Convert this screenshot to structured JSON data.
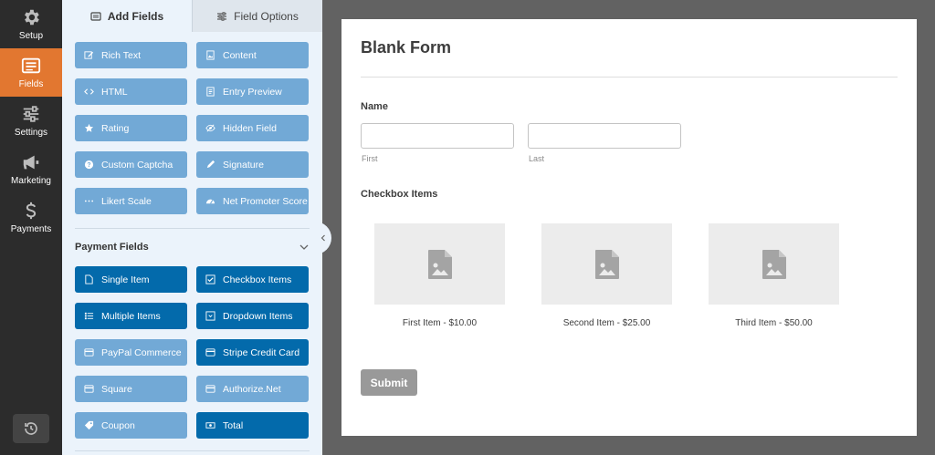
{
  "nav": {
    "items": [
      {
        "label": "Setup",
        "icon": "gear-icon"
      },
      {
        "label": "Fields",
        "icon": "fields-list-icon"
      },
      {
        "label": "Settings",
        "icon": "sliders-icon"
      },
      {
        "label": "Marketing",
        "icon": "megaphone-icon"
      },
      {
        "label": "Payments",
        "icon": "dollar-icon"
      }
    ],
    "active": "Fields",
    "history_icon": "history-icon"
  },
  "tabs": {
    "add_fields": "Add Fields",
    "field_options": "Field Options"
  },
  "fancy_fields": [
    {
      "label": "Rich Text",
      "icon": "pencil-square-icon"
    },
    {
      "label": "Content",
      "icon": "image-doc-icon"
    },
    {
      "label": "HTML",
      "icon": "code-icon"
    },
    {
      "label": "Entry Preview",
      "icon": "doc-lines-icon"
    },
    {
      "label": "Rating",
      "icon": "star-icon"
    },
    {
      "label": "Hidden Field",
      "icon": "eye-slash-icon"
    },
    {
      "label": "Custom Captcha",
      "icon": "question-circle-icon"
    },
    {
      "label": "Signature",
      "icon": "pen-icon"
    },
    {
      "label": "Likert Scale",
      "icon": "dots-icon"
    },
    {
      "label": "Net Promoter Score",
      "icon": "gauge-icon"
    }
  ],
  "payment_section": {
    "title": "Payment Fields",
    "fields": [
      {
        "label": "Single Item",
        "icon": "file-icon",
        "style": "dark"
      },
      {
        "label": "Checkbox Items",
        "icon": "checkbox-icon",
        "style": "dark"
      },
      {
        "label": "Multiple Items",
        "icon": "list-icon",
        "style": "dark"
      },
      {
        "label": "Dropdown Items",
        "icon": "dropdown-icon",
        "style": "dark"
      },
      {
        "label": "PayPal Commerce",
        "icon": "card-icon",
        "style": "light"
      },
      {
        "label": "Stripe Credit Card",
        "icon": "card-icon",
        "style": "dark"
      },
      {
        "label": "Square",
        "icon": "card-icon",
        "style": "light"
      },
      {
        "label": "Authorize.Net",
        "icon": "card-icon",
        "style": "light"
      },
      {
        "label": "Coupon",
        "icon": "tag-icon",
        "style": "light"
      },
      {
        "label": "Total",
        "icon": "money-icon",
        "style": "dark"
      }
    ]
  },
  "form": {
    "title": "Blank Form",
    "name_label": "Name",
    "first_sub": "First",
    "last_sub": "Last",
    "checkbox_label": "Checkbox Items",
    "items": [
      {
        "caption": "First Item - $10.00"
      },
      {
        "caption": "Second Item - $25.00"
      },
      {
        "caption": "Third Item - $50.00"
      }
    ],
    "submit_label": "Submit"
  },
  "colors": {
    "nav_bg": "#2c2c2c",
    "nav_active": "#e27730",
    "field_light": "#72a9d6",
    "field_dark": "#036aab",
    "panel_bg": "#ebf3fb",
    "canvas_bg": "#626262",
    "submit_bg": "#999999"
  }
}
